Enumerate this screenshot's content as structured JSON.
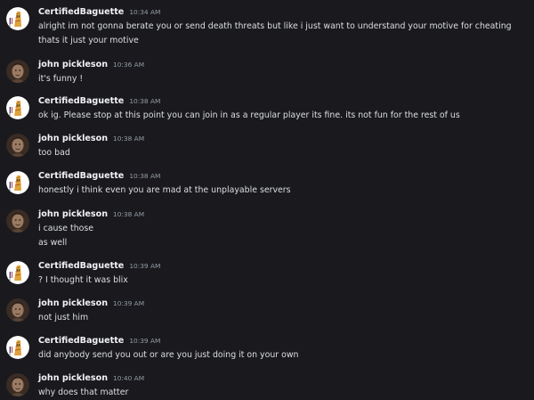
{
  "messages": [
    {
      "author": "CertifiedBaguette",
      "avatar": "baguette",
      "time": "10:34 AM",
      "lines": [
        "alright im not gonna berate you or send death threats but like i just want to understand your motive for cheating",
        "thats it just your motive"
      ]
    },
    {
      "author": "john pickleson",
      "avatar": "pickleson",
      "time": "10:36 AM",
      "lines": [
        "it's funny !"
      ]
    },
    {
      "author": "CertifiedBaguette",
      "avatar": "baguette",
      "time": "10:38 AM",
      "lines": [
        "ok ig. Please stop at this point you can join in as a regular player its fine. its not fun for the rest of us"
      ]
    },
    {
      "author": "john pickleson",
      "avatar": "pickleson",
      "time": "10:38 AM",
      "lines": [
        "too bad"
      ]
    },
    {
      "author": "CertifiedBaguette",
      "avatar": "baguette",
      "time": "10:38 AM",
      "lines": [
        "honestly i think even you are mad at the unplayable servers"
      ]
    },
    {
      "author": "john pickleson",
      "avatar": "pickleson",
      "time": "10:38 AM",
      "lines": [
        "i cause those",
        "as well"
      ]
    },
    {
      "author": "CertifiedBaguette",
      "avatar": "baguette",
      "time": "10:39 AM",
      "lines": [
        "? I thought it was blix"
      ]
    },
    {
      "author": "john pickleson",
      "avatar": "pickleson",
      "time": "10:39 AM",
      "lines": [
        "not just him"
      ]
    },
    {
      "author": "CertifiedBaguette",
      "avatar": "baguette",
      "time": "10:39 AM",
      "lines": [
        "did anybody send you out or are you just doing it on your own"
      ]
    },
    {
      "author": "john pickleson",
      "avatar": "pickleson",
      "time": "10:40 AM",
      "lines": [
        "why does that matter"
      ]
    }
  ],
  "colors": {
    "background": "#1a1a1e",
    "username": "#f2f3f5",
    "message": "#dbdee1",
    "timestamp": "#949ba4"
  }
}
